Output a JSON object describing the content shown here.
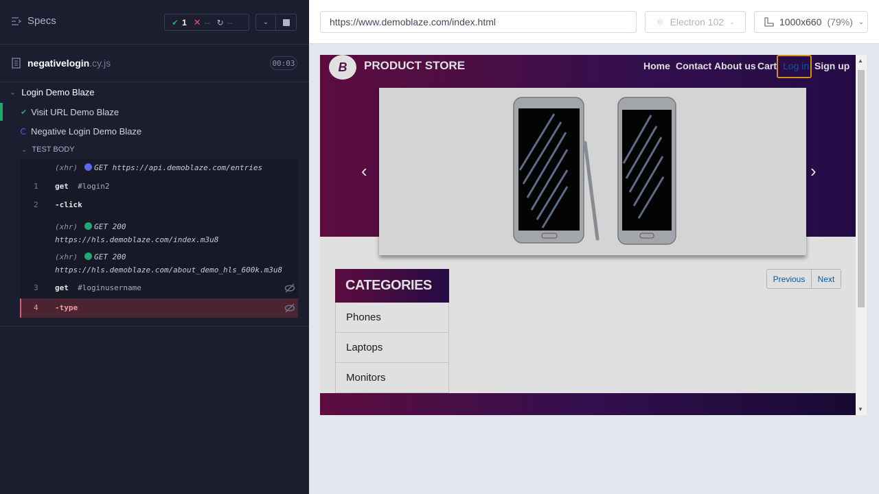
{
  "reporter": {
    "specs_label": "Specs",
    "stats": {
      "passed": "1",
      "failed": "--",
      "pending": "--"
    },
    "spec_file": {
      "name": "negativelogin",
      "ext": ".cy.js",
      "duration": "00:03"
    },
    "suite_title": "Login Demo Blaze",
    "tests": [
      {
        "title": "Visit URL Demo Blaze",
        "state": "passed"
      },
      {
        "title": "Negative Login Demo Blaze",
        "state": "running"
      }
    ],
    "section_label": "TEST BODY",
    "commands": [
      {
        "num": "",
        "prefix": "(xhr)",
        "method": "GET https://api.demoblaze.com/entries",
        "dot": "#5a6af0"
      },
      {
        "num": "1",
        "name": "get",
        "selector": "#login2"
      },
      {
        "num": "2",
        "name": "-click",
        "selector": ""
      },
      {
        "num": "",
        "prefix": "(xhr)",
        "method": "GET 200",
        "url": "https://hls.demoblaze.com/index.m3u8",
        "dot": "#1fa971"
      },
      {
        "num": "",
        "prefix": "(xhr)",
        "method": "GET 200",
        "url": "https://hls.demoblaze.com/about_demo_hls_600k.m3u8",
        "dot": "#1fa971"
      },
      {
        "num": "3",
        "name": "get",
        "selector": "#loginusername"
      },
      {
        "num": "4",
        "name": "-type",
        "selector": ""
      }
    ]
  },
  "aut": {
    "url": "https://www.demoblaze.com/index.html",
    "browser": "Electron 102",
    "viewport": "1000x660",
    "zoom": "(79%)"
  },
  "site": {
    "logo_letter": "B",
    "brand": "PRODUCT STORE",
    "nav": [
      "Home",
      "Contact",
      "About us",
      "Cart",
      "Log in",
      "Sign up"
    ],
    "categories_title": "CATEGORIES",
    "categories": [
      "Phones",
      "Laptops",
      "Monitors"
    ],
    "pagination": {
      "prev": "Previous",
      "next": "Next"
    }
  },
  "colors": {
    "passed": "#1fa971",
    "failed": "#e45770",
    "accent": "#f5a623"
  }
}
